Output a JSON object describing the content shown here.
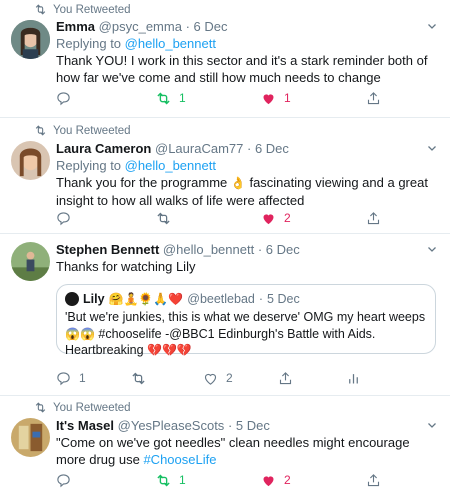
{
  "tweets": [
    {
      "retweet_label": "You Retweeted",
      "name": "Emma",
      "handle": "@psyc_emma",
      "dot": "·",
      "date": "6 Dec",
      "reply_prefix": "Replying to",
      "reply_handle": "@hello_bennett",
      "text": "Thank YOU! I work in this sector and it's a stark reminder both of how far we've come and still how much needs to change",
      "retweets": "1",
      "likes": "1"
    },
    {
      "retweet_label": "You Retweeted",
      "name": "Laura Cameron",
      "handle": "@LauraCam77",
      "dot": "·",
      "date": "6 Dec",
      "reply_prefix": "Replying to",
      "reply_handle": "@hello_bennett",
      "text_a": "Thank you for the programme",
      "text_b": "fascinating viewing and a great insight to how all walks of life were affected",
      "likes": "2"
    },
    {
      "name": "Stephen Bennett",
      "handle": "@hello_bennett",
      "dot": "·",
      "date": "6 Dec",
      "text": "Thanks for watching Lily",
      "quote": {
        "name": "Lily",
        "handle": "@beetlebad",
        "dot": "·",
        "date": "5 Dec",
        "text_a": "'But we're junkies, this is what we deserve' OMG my heart weeps",
        "text_b": "#chooselife -@BBC1  Edinburgh's Battle with Aids. Heartbreaking"
      },
      "replies": "1",
      "likes": "2"
    },
    {
      "retweet_label": "You Retweeted",
      "name": "It's Masel",
      "handle": "@YesPleaseScots",
      "dot": "·",
      "date": "5 Dec",
      "text": "\"Come on we've got needles\" clean needles might encourage more drug use",
      "hashtag": "#ChooseLife",
      "retweets": "1",
      "likes": "2"
    }
  ],
  "colors": {
    "retweet_green": "#17bf63",
    "like_red": "#e0245e",
    "link_blue": "#1da1f2",
    "muted": "#657786"
  },
  "icons": [
    "retweet-icon",
    "reply-icon",
    "heart-icon",
    "share-icon",
    "analytics-icon",
    "chevron-down-icon"
  ]
}
